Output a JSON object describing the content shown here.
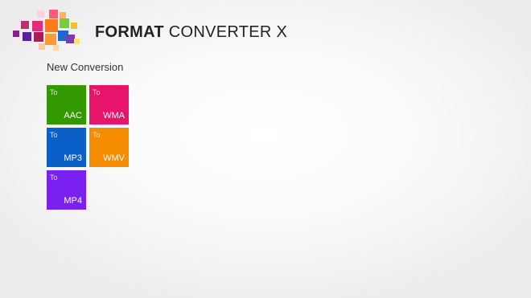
{
  "app": {
    "title_bold": "FORMAT",
    "title_rest": " CONVERTER X"
  },
  "section": {
    "heading": "New Conversion"
  },
  "tiles": [
    {
      "prefix": "To",
      "format": "AAC",
      "color": "#339900"
    },
    {
      "prefix": "To",
      "format": "WMA",
      "color": "#e8136b"
    },
    {
      "prefix": "To",
      "format": "MP3",
      "color": "#0a5fc9"
    },
    {
      "prefix": "To",
      "format": "WMV",
      "color": "#f58b00"
    },
    {
      "prefix": "To",
      "format": "MP4",
      "color": "#7a20f0"
    }
  ]
}
